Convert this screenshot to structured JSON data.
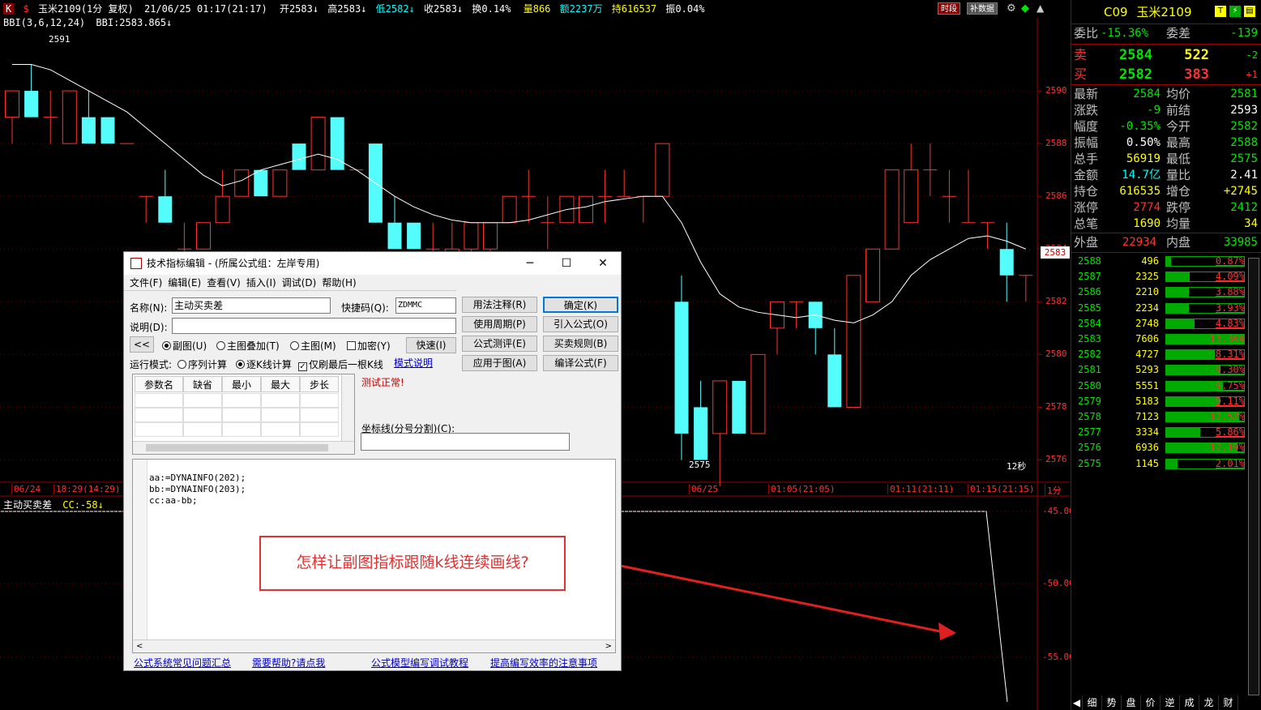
{
  "topbar": {
    "code_letter": "K",
    "symbol_name": "玉米2109(1分 复权)",
    "datetime": "21/06/25 01:17(21:17)",
    "open": "开2583↓",
    "high": "高2583↓",
    "low": "低2582↓",
    "close": "收2583↓",
    "turnover": "换0.14%",
    "volume": "量866",
    "amount": "额2237万",
    "holding": "持616537",
    "amplitude": "振0.04%",
    "btn_period": "时段",
    "btn_supplement": "补数据"
  },
  "main_indicator": {
    "label": "BBI(3,6,12,24)",
    "value": "BBI:2583.865↓",
    "high_marker": "2591",
    "low_marker": "2575",
    "countdown": "12秒"
  },
  "price_axis": [
    "2590",
    "2588",
    "2586",
    "2584",
    "2582",
    "2580",
    "2578",
    "2576"
  ],
  "current_price_tag": "2583",
  "time_axis": [
    "06/24",
    "18:29(14:29)",
    "06/25",
    "01:05(21:05)",
    "01:11(21:11)",
    "01:15(21:15)",
    "1分"
  ],
  "sub_indicator": {
    "label": "主动买卖差",
    "value": "CC:-58↓",
    "axis": [
      "-45.00",
      "-50.00",
      "-55.00"
    ]
  },
  "chart_data": {
    "type": "candlestick",
    "ylim": [
      2575,
      2591
    ],
    "candles": [
      {
        "o": 2589,
        "h": 2590,
        "l": 2588,
        "c": 2590
      },
      {
        "o": 2590,
        "h": 2591,
        "l": 2589,
        "c": 2589
      },
      {
        "o": 2589,
        "h": 2590,
        "l": 2588,
        "c": 2589
      },
      {
        "o": 2588,
        "h": 2590,
        "l": 2588,
        "c": 2590
      },
      {
        "o": 2589,
        "h": 2590,
        "l": 2588,
        "c": 2588
      },
      {
        "o": 2589,
        "h": 2589,
        "l": 2588,
        "c": 2588
      },
      {
        "o": 2588,
        "h": 2588,
        "l": 2588,
        "c": 2588
      },
      {
        "o": 2586,
        "h": 2586,
        "l": 2585,
        "c": 2586
      },
      {
        "o": 2586,
        "h": 2587,
        "l": 2585,
        "c": 2585
      },
      {
        "o": 2584,
        "h": 2585,
        "l": 2583,
        "c": 2584
      },
      {
        "o": 2584,
        "h": 2585,
        "l": 2584,
        "c": 2585
      },
      {
        "o": 2585,
        "h": 2587,
        "l": 2585,
        "c": 2586
      },
      {
        "o": 2586,
        "h": 2587,
        "l": 2586,
        "c": 2587
      },
      {
        "o": 2587,
        "h": 2587,
        "l": 2586,
        "c": 2586
      },
      {
        "o": 2586,
        "h": 2587,
        "l": 2586,
        "c": 2587
      },
      {
        "o": 2588,
        "h": 2588,
        "l": 2587,
        "c": 2587
      },
      {
        "o": 2587,
        "h": 2589,
        "l": 2587,
        "c": 2589
      },
      {
        "o": 2589,
        "h": 2589,
        "l": 2587,
        "c": 2587
      },
      {
        "o": 2587,
        "h": 2587,
        "l": 2587,
        "c": 2587
      },
      {
        "o": 2588,
        "h": 2588,
        "l": 2585,
        "c": 2585
      },
      {
        "o": 2585,
        "h": 2586,
        "l": 2584,
        "c": 2584
      },
      {
        "o": 2585,
        "h": 2585,
        "l": 2584,
        "c": 2584
      },
      {
        "o": 2584,
        "h": 2585,
        "l": 2583,
        "c": 2584
      },
      {
        "o": 2583,
        "h": 2585,
        "l": 2583,
        "c": 2584
      },
      {
        "o": 2584,
        "h": 2585,
        "l": 2583,
        "c": 2585
      },
      {
        "o": 2584,
        "h": 2585,
        "l": 2583,
        "c": 2585
      },
      {
        "o": 2585,
        "h": 2586,
        "l": 2585,
        "c": 2586
      },
      {
        "o": 2586,
        "h": 2587,
        "l": 2585,
        "c": 2586
      },
      {
        "o": 2585,
        "h": 2586,
        "l": 2584,
        "c": 2585
      },
      {
        "o": 2585,
        "h": 2586,
        "l": 2585,
        "c": 2586
      },
      {
        "o": 2585,
        "h": 2586,
        "l": 2585,
        "c": 2586
      },
      {
        "o": 2586,
        "h": 2587,
        "l": 2585,
        "c": 2586
      },
      {
        "o": 2586,
        "h": 2587,
        "l": 2586,
        "c": 2586
      },
      {
        "o": 2586,
        "h": 2586,
        "l": 2585,
        "c": 2586
      },
      {
        "o": 2586,
        "h": 2588,
        "l": 2586,
        "c": 2588
      },
      {
        "o": 2582,
        "h": 2583,
        "l": 2576,
        "c": 2577
      },
      {
        "o": 2578,
        "h": 2579,
        "l": 2576,
        "c": 2576
      },
      {
        "o": 2577,
        "h": 2579,
        "l": 2575,
        "c": 2579
      },
      {
        "o": 2579,
        "h": 2579,
        "l": 2577,
        "c": 2577
      },
      {
        "o": 2577,
        "h": 2580,
        "l": 2577,
        "c": 2580
      },
      {
        "o": 2581,
        "h": 2582,
        "l": 2580,
        "c": 2582
      },
      {
        "o": 2582,
        "h": 2582,
        "l": 2581,
        "c": 2582
      },
      {
        "o": 2582,
        "h": 2582,
        "l": 2580,
        "c": 2581
      },
      {
        "o": 2580,
        "h": 2581,
        "l": 2578,
        "c": 2578
      },
      {
        "o": 2578,
        "h": 2583,
        "l": 2578,
        "c": 2583
      },
      {
        "o": 2582,
        "h": 2584,
        "l": 2582,
        "c": 2584
      },
      {
        "o": 2584,
        "h": 2587,
        "l": 2584,
        "c": 2587
      },
      {
        "o": 2585,
        "h": 2588,
        "l": 2585,
        "c": 2587
      },
      {
        "o": 2587,
        "h": 2588,
        "l": 2586,
        "c": 2587
      },
      {
        "o": 2586,
        "h": 2587,
        "l": 2585,
        "c": 2586
      },
      {
        "o": 2585,
        "h": 2587,
        "l": 2585,
        "c": 2585
      },
      {
        "o": 2585,
        "h": 2585,
        "l": 2584,
        "c": 2585
      },
      {
        "o": 2584,
        "h": 2585,
        "l": 2582,
        "c": 2583
      },
      {
        "o": 2583,
        "h": 2583,
        "l": 2582,
        "c": 2583
      }
    ],
    "bbi": [
      2591,
      2591,
      2590.8,
      2590.4,
      2590,
      2589.6,
      2589.2,
      2588.6,
      2588,
      2587.4,
      2586.8,
      2586.4,
      2586.6,
      2587,
      2587.2,
      2587.4,
      2587.6,
      2587.4,
      2587,
      2586.5,
      2586,
      2585.6,
      2585.3,
      2585.1,
      2585,
      2585,
      2585,
      2585.1,
      2585.3,
      2585.5,
      2585.6,
      2585.8,
      2585.9,
      2586,
      2586,
      2585,
      2583.5,
      2582.3,
      2581.8,
      2581.6,
      2581.5,
      2581.4,
      2581.5,
      2581.3,
      2581.2,
      2581.5,
      2582,
      2583,
      2583.6,
      2584,
      2584.4,
      2584.5,
      2584.3,
      2584
    ]
  },
  "quote": {
    "contract": "C09",
    "name": "玉米2109",
    "weibi_label": "委比",
    "weibi": "-15.36%",
    "weicha_label": "委差",
    "weicha": "-139",
    "sell_label": "卖",
    "sell_price": "2584",
    "sell_vol": "522",
    "sell_chg": "-2",
    "buy_label": "买",
    "buy_price": "2582",
    "buy_vol": "383",
    "buy_chg": "+1",
    "rows": [
      {
        "l1": "最新",
        "v1": "2584",
        "c1": "green",
        "l2": "均价",
        "v2": "2581",
        "c2": "green"
      },
      {
        "l1": "涨跌",
        "v1": "-9",
        "c1": "green",
        "l2": "前结",
        "v2": "2593",
        "c2": "white"
      },
      {
        "l1": "幅度",
        "v1": "-0.35%",
        "c1": "green",
        "l2": "今开",
        "v2": "2582",
        "c2": "green"
      },
      {
        "l1": "振幅",
        "v1": "0.50%",
        "c1": "white",
        "l2": "最高",
        "v2": "2588",
        "c2": "green"
      },
      {
        "l1": "总手",
        "v1": "56919",
        "c1": "yellow",
        "l2": "最低",
        "v2": "2575",
        "c2": "green"
      },
      {
        "l1": "金额",
        "v1": "14.7亿",
        "c1": "cyan",
        "l2": "量比",
        "v2": "2.41",
        "c2": "white"
      },
      {
        "l1": "持仓",
        "v1": "616535",
        "c1": "yellow",
        "l2": "增仓",
        "v2": "+2745",
        "c2": "yellow"
      },
      {
        "l1": "涨停",
        "v1": "2774",
        "c1": "red",
        "l2": "跌停",
        "v2": "2412",
        "c2": "green"
      },
      {
        "l1": "总笔",
        "v1": "1690",
        "c1": "yellow",
        "l2": "均量",
        "v2": "34",
        "c2": "yellow"
      }
    ],
    "outer_label": "外盘",
    "outer": "22934",
    "inner_label": "内盘",
    "inner": "33985",
    "depth": [
      {
        "price": "2588",
        "vol": "496",
        "pct": "0.87%",
        "frac": 0.0087
      },
      {
        "price": "2587",
        "vol": "2325",
        "pct": "4.09%",
        "frac": 0.0409
      },
      {
        "price": "2586",
        "vol": "2210",
        "pct": "3.88%",
        "frac": 0.0388
      },
      {
        "price": "2585",
        "vol": "2234",
        "pct": "3.93%",
        "frac": 0.0393
      },
      {
        "price": "2584",
        "vol": "2748",
        "pct": "4.83%",
        "frac": 0.0483
      },
      {
        "price": "2583",
        "vol": "7606",
        "pct": "13.36%",
        "frac": 0.1336
      },
      {
        "price": "2582",
        "vol": "4727",
        "pct": "8.31%",
        "frac": 0.0831
      },
      {
        "price": "2581",
        "vol": "5293",
        "pct": "9.30%",
        "frac": 0.093
      },
      {
        "price": "2580",
        "vol": "5551",
        "pct": "9.75%",
        "frac": 0.0975
      },
      {
        "price": "2579",
        "vol": "5183",
        "pct": "9.11%",
        "frac": 0.0911
      },
      {
        "price": "2578",
        "vol": "7123",
        "pct": "12.52%",
        "frac": 0.1252
      },
      {
        "price": "2577",
        "vol": "3334",
        "pct": "5.86%",
        "frac": 0.0586
      },
      {
        "price": "2576",
        "vol": "6936",
        "pct": "12.19%",
        "frac": 0.1219
      },
      {
        "price": "2575",
        "vol": "1145",
        "pct": "2.01%",
        "frac": 0.0201
      }
    ],
    "tabs": [
      "细",
      "势",
      "盘",
      "价",
      "逆",
      "成",
      "龙",
      "财"
    ]
  },
  "dialog": {
    "title": "技术指标编辑 - (所属公式组：左岸专用)",
    "menu": [
      "文件(F)",
      "编辑(E)",
      "查看(V)",
      "插入(I)",
      "调试(D)",
      "帮助(H)"
    ],
    "name_label": "名称(N):",
    "name_value": "主动买卖差",
    "shortcut_label": "快捷码(Q):",
    "shortcut_value": "ZDMMC",
    "desc_label": "说明(D):",
    "desc_value": "",
    "collapse_btn": "<<",
    "radio_sub": "副图(U)",
    "radio_overlay": "主图叠加(T)",
    "radio_main": "主图(M)",
    "check_encrypt": "加密(Y)",
    "btn_quick": "快速(I)",
    "run_mode_label": "运行模式:",
    "radio_seq": "序列计算",
    "radio_tick": "逐K线计算",
    "check_last": "仅刷最后一根K线",
    "mode_help": "模式说明",
    "btn_usage": "用法注释(R)",
    "btn_ok": "确定(K)",
    "btn_period": "使用周期(P)",
    "btn_import": "引入公式(O)",
    "btn_test": "公式测评(E)",
    "btn_rule": "买卖规则(B)",
    "btn_apply": "应用于图(A)",
    "btn_compile": "编译公式(F)",
    "param_headers": [
      "参数名",
      "缺省",
      "最小",
      "最大",
      "步长"
    ],
    "test_status": "测试正常!",
    "coord_label": "坐标线(分号分割)(C):",
    "coord_value": "",
    "code": "aa:=DYNAINFO(202);\nbb:=DYNAINFO(203);\ncc:aa-bb;",
    "links": [
      "公式系统常见问题汇总",
      "需要帮助?请点我",
      "公式模型编写调试教程",
      "提高编写效率的注意事项"
    ]
  },
  "callout_text": "怎样让副图指标跟随k线连续画线?"
}
